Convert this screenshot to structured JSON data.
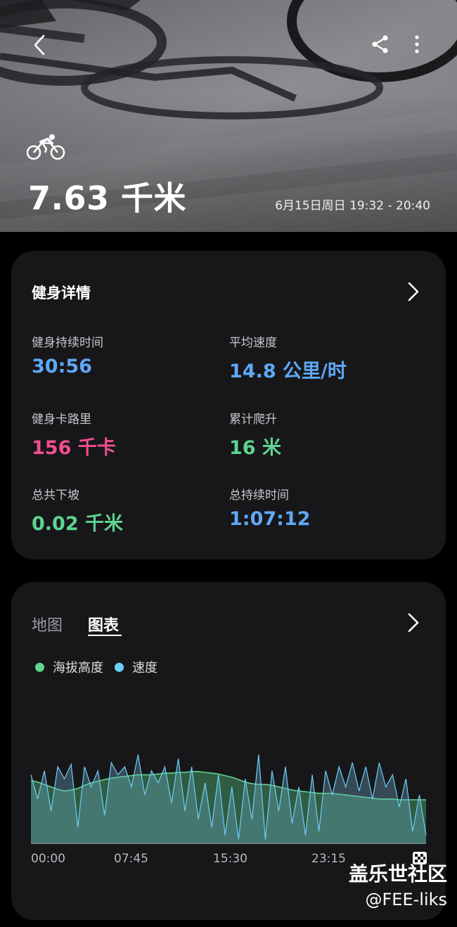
{
  "header": {
    "distance": "7.63 千米",
    "datetime": "6月15日周日 19:32 - 20:40"
  },
  "icons": {
    "back": "chevron-left-icon",
    "share": "share-icon",
    "more": "more-vertical-icon",
    "activity": "cycling-icon"
  },
  "details": {
    "title": "健身详情",
    "metrics": [
      {
        "label": "健身持续时间",
        "value": "30:56",
        "color": "#5fa8f5"
      },
      {
        "label": "平均速度",
        "value": "14.8 公里/时",
        "color": "#5fa8f5"
      },
      {
        "label": "健身卡路里",
        "value": "156 千卡",
        "color": "#f0508a"
      },
      {
        "label": "累计爬升",
        "value": "16 米",
        "color": "#5fd48f"
      },
      {
        "label": "总共下坡",
        "value": "0.02 千米",
        "color": "#5fd48f"
      },
      {
        "label": "总持续时间",
        "value": "1:07:12",
        "color": "#5fa8f5"
      }
    ]
  },
  "chart_section": {
    "tabs": [
      {
        "label": "地图",
        "selected": false
      },
      {
        "label": "图表",
        "selected": true
      }
    ],
    "legend": [
      {
        "label": "海拔高度",
        "color": "#5fd48f"
      },
      {
        "label": "速度",
        "color": "#6ccff6"
      }
    ]
  },
  "chart_data": {
    "type": "area",
    "x_ticks": [
      "00:00",
      "07:45",
      "15:30",
      "23:15"
    ],
    "series": [
      {
        "name": "海拔高度",
        "color": "#5fd48f",
        "values": [
          0.78,
          0.76,
          0.73,
          0.7,
          0.67,
          0.65,
          0.66,
          0.68,
          0.72,
          0.75,
          0.77,
          0.79,
          0.81,
          0.82,
          0.83,
          0.84,
          0.85,
          0.85,
          0.85,
          0.86,
          0.87,
          0.87,
          0.88,
          0.88,
          0.89,
          0.89,
          0.88,
          0.87,
          0.86,
          0.84,
          0.82,
          0.79,
          0.76,
          0.74,
          0.73,
          0.73,
          0.72,
          0.7,
          0.68,
          0.66,
          0.65,
          0.64,
          0.63,
          0.62,
          0.62,
          0.62,
          0.61,
          0.6,
          0.59,
          0.58,
          0.57,
          0.56,
          0.55,
          0.55,
          0.55,
          0.54,
          0.54,
          0.54,
          0.54,
          0.54
        ]
      },
      {
        "name": "速度",
        "color": "#6ccff6",
        "values": [
          0.85,
          0.55,
          0.9,
          0.4,
          0.95,
          0.8,
          0.98,
          0.2,
          0.95,
          0.7,
          0.9,
          0.35,
          1.0,
          0.85,
          0.95,
          0.7,
          1.1,
          0.6,
          0.9,
          0.75,
          0.95,
          0.5,
          1.05,
          0.4,
          0.95,
          0.3,
          0.75,
          0.2,
          0.85,
          0.1,
          0.7,
          0.05,
          0.8,
          0.3,
          1.1,
          0.05,
          0.9,
          0.4,
          0.95,
          0.25,
          0.7,
          0.1,
          0.85,
          0.15,
          0.9,
          0.6,
          0.95,
          0.7,
          1.0,
          0.65,
          0.95,
          0.55,
          1.0,
          0.7,
          0.85,
          0.45,
          0.8,
          0.15,
          0.6,
          0.1
        ]
      }
    ]
  },
  "watermark": {
    "line1": "盖乐世社区",
    "line2": "@FEE-liks"
  }
}
